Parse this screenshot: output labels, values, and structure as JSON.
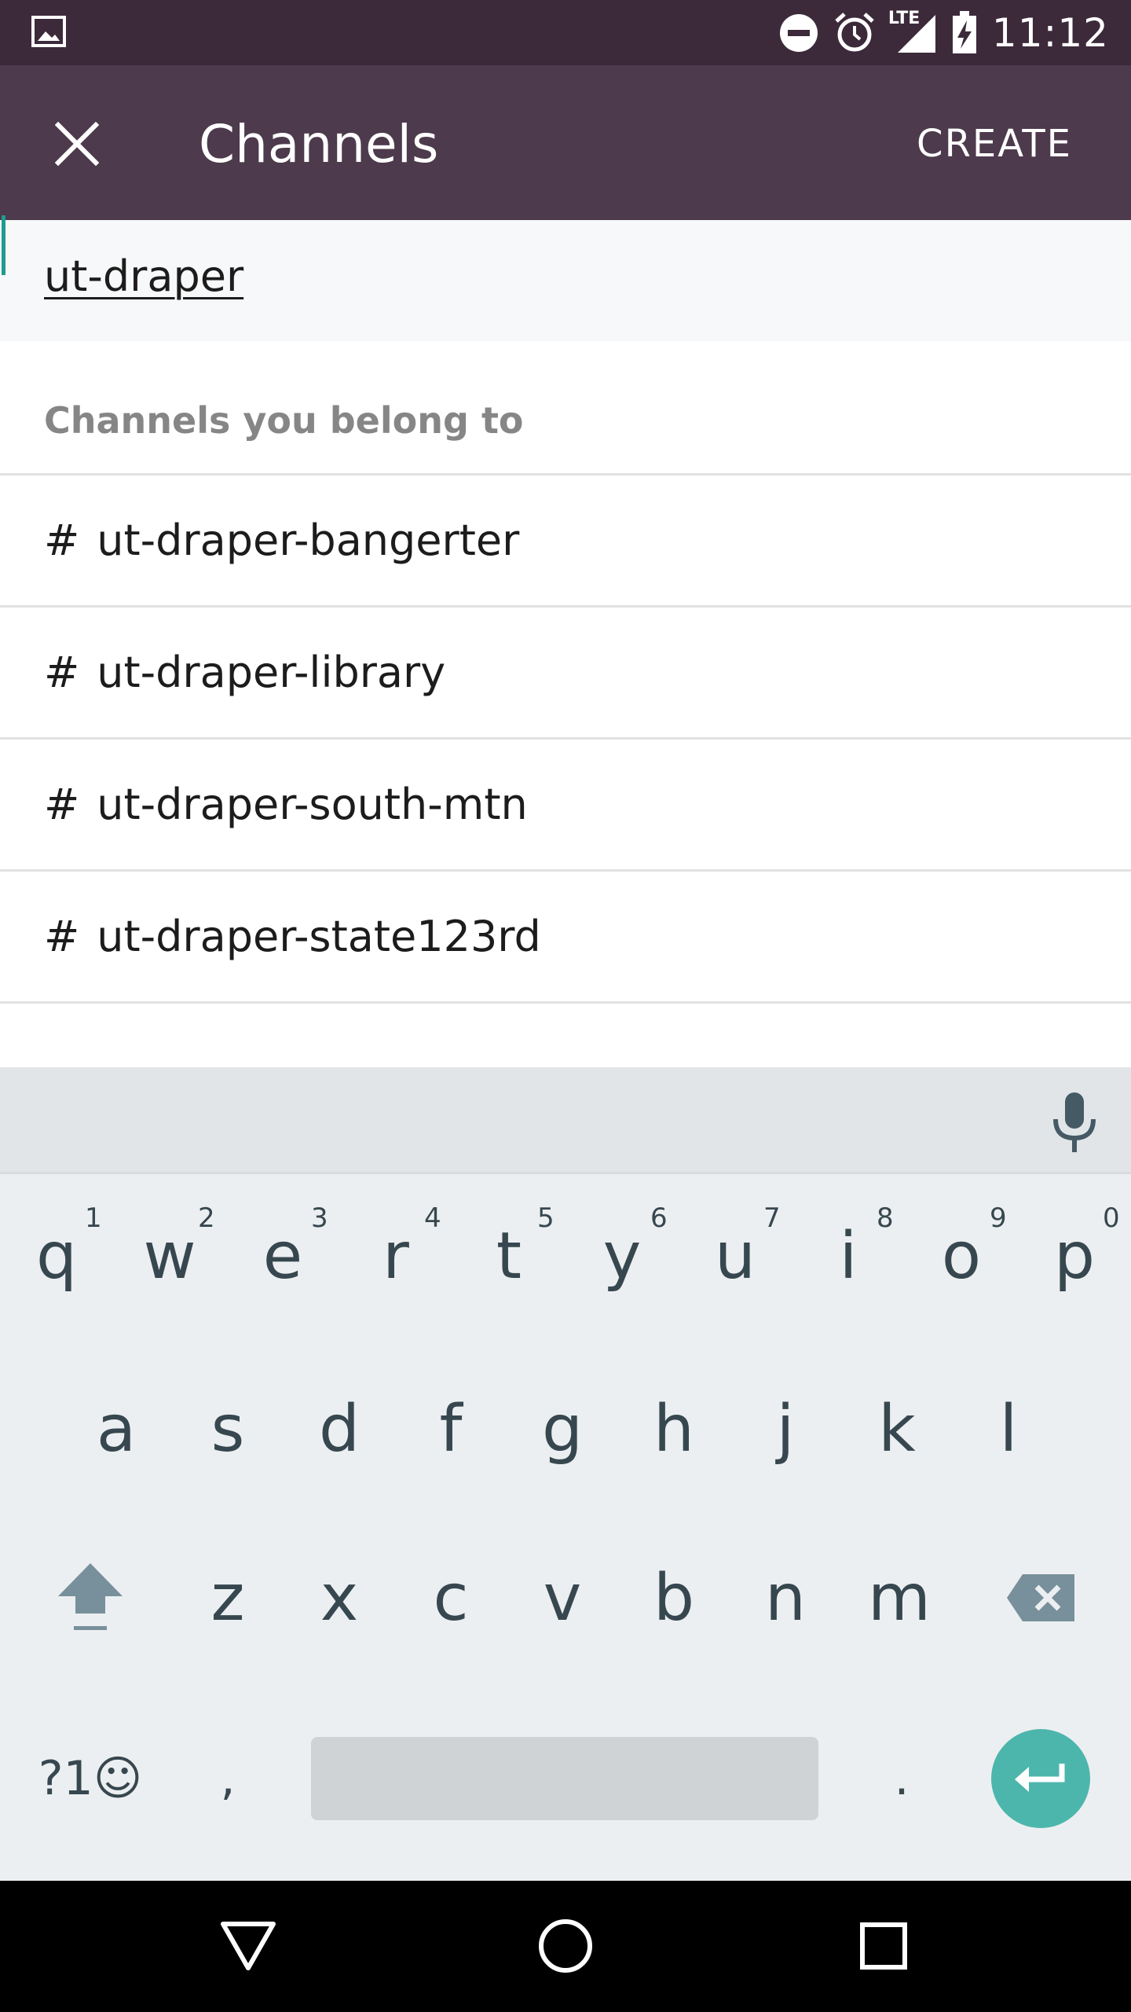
{
  "status_bar": {
    "time": "11:12",
    "network": "LTE",
    "icons": [
      "image-icon",
      "do-not-disturb-icon",
      "alarm-icon",
      "signal-icon",
      "battery-charging-icon"
    ]
  },
  "app_bar": {
    "title": "Channels",
    "create_label": "CREATE",
    "close_icon": "close-icon"
  },
  "search": {
    "value": "ut-draper"
  },
  "section": {
    "header": "Channels you belong to"
  },
  "channels": [
    {
      "prefix": "#",
      "name": "ut-draper-bangerter"
    },
    {
      "prefix": "#",
      "name": "ut-draper-library"
    },
    {
      "prefix": "#",
      "name": "ut-draper-south-mtn"
    },
    {
      "prefix": "#",
      "name": "ut-draper-state123rd"
    }
  ],
  "keyboard": {
    "row1": [
      "q",
      "w",
      "e",
      "r",
      "t",
      "y",
      "u",
      "i",
      "o",
      "p"
    ],
    "row1_hints": [
      "1",
      "2",
      "3",
      "4",
      "5",
      "6",
      "7",
      "8",
      "9",
      "0"
    ],
    "row2": [
      "a",
      "s",
      "d",
      "f",
      "g",
      "h",
      "j",
      "k",
      "l"
    ],
    "row3": [
      "z",
      "x",
      "c",
      "v",
      "b",
      "n",
      "m"
    ],
    "symbols_label": "?1☺",
    "comma": ",",
    "period": ".",
    "accent_color": "#4db6ac"
  },
  "nav_bar": {
    "icons": [
      "back-icon",
      "home-icon",
      "recents-icon"
    ]
  }
}
